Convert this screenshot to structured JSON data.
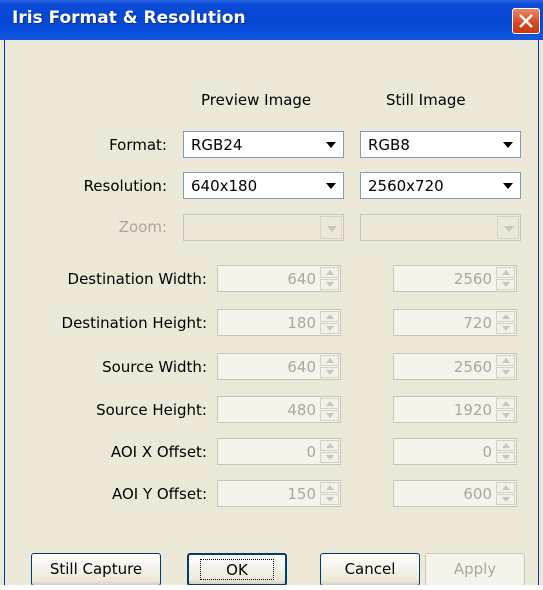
{
  "window": {
    "title": "Iris Format & Resolution"
  },
  "columns": {
    "preview": "Preview Image",
    "still": "Still Image"
  },
  "rows": {
    "format": {
      "label": "Format:",
      "preview": "RGB24",
      "still": "RGB8"
    },
    "resolution": {
      "label": "Resolution:",
      "preview": "640x180",
      "still": "2560x720"
    },
    "zoom": {
      "label": "Zoom:",
      "preview": "",
      "still": ""
    }
  },
  "spinners": [
    {
      "label": "Destination Width:",
      "preview": "640",
      "still": "2560"
    },
    {
      "label": "Destination Height:",
      "preview": "180",
      "still": "720"
    },
    {
      "label": "Source Width:",
      "preview": "640",
      "still": "2560"
    },
    {
      "label": "Source Height:",
      "preview": "480",
      "still": "1920"
    },
    {
      "label": "AOI X Offset:",
      "preview": "0",
      "still": "0"
    },
    {
      "label": "AOI Y Offset:",
      "preview": "150",
      "still": "600"
    }
  ],
  "buttons": {
    "still_capture": "Still Capture",
    "ok": "OK",
    "cancel": "Cancel",
    "apply": "Apply"
  },
  "colors": {
    "titlebar": "#0647d2",
    "dialog_bg": "#ece9d8",
    "disabled_text": "#aca899"
  }
}
